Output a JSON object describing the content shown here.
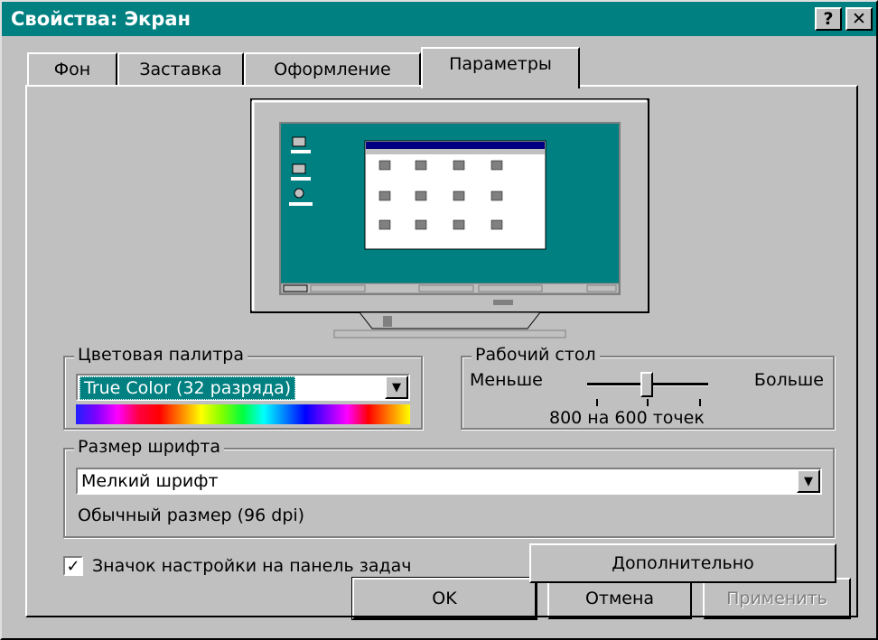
{
  "window": {
    "title": "Свойства: Экран",
    "help_label": "?",
    "close_label": "✕"
  },
  "tabs": [
    "Фон",
    "Заставка",
    "Оформление",
    "Параметры"
  ],
  "colors": {
    "title_bar": "#008080",
    "face": "#c0c0c0",
    "preview_desktop": "#008080",
    "selection": "#008080"
  },
  "color_palette": {
    "label": "Цветовая палитра",
    "value": "True Color (32 разряда)"
  },
  "desktop_area": {
    "label": "Рабочий стол",
    "less": "Меньше",
    "more": "Больше",
    "value_text": "800 на 600 точек",
    "slider_level": 0.5
  },
  "font_size": {
    "label": "Размер шрифта",
    "value": "Мелкий шрифт",
    "info": "Обычный размер (96 dpi)"
  },
  "taskbar_checkbox": {
    "label": "Значок настройки на панель задач",
    "checked": true
  },
  "buttons": {
    "advanced": "Дополнительно",
    "ok": "OK",
    "cancel": "Отмена",
    "apply": "Применить"
  },
  "icons": [
    "monitor-icon",
    "checkbox-check-icon",
    "dropdown-arrow-icon",
    "help-icon",
    "close-icon"
  ]
}
